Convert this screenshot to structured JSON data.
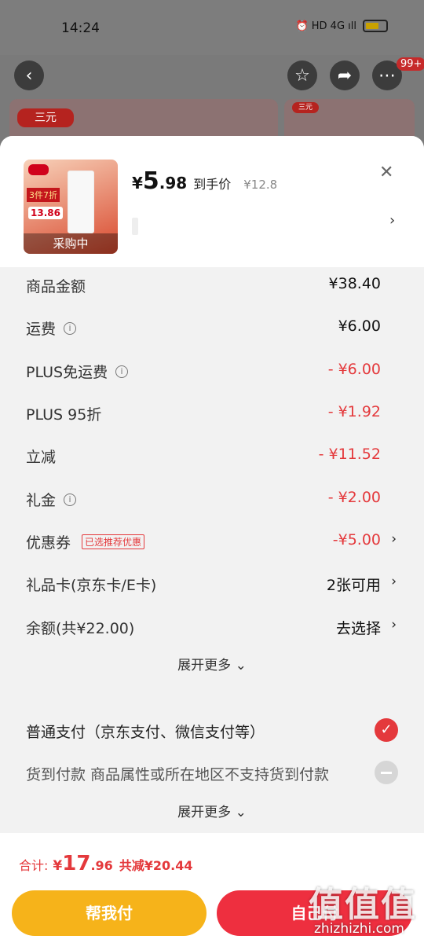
{
  "status": {
    "time": "14:24",
    "icons": "⏰ HD 4G ıll"
  },
  "nav": {
    "badge": "99+"
  },
  "background": {
    "logo1": "三元",
    "logo2": "三元"
  },
  "product": {
    "tag1": "3件7折",
    "tag2": "13.86",
    "status": "采购中",
    "price_symbol": "¥",
    "price_int": "5",
    "price_dec": ".98",
    "price_label": "到手价",
    "original_price": "¥12.8"
  },
  "summary": {
    "rows": [
      {
        "label": "商品金额",
        "value": "¥38.40",
        "red": false
      },
      {
        "label": "运费",
        "value": "¥6.00",
        "red": false,
        "info": true
      },
      {
        "label": "PLUS免运费",
        "value": "- ¥6.00",
        "red": true,
        "info": true
      },
      {
        "label": "PLUS 95折",
        "value": "- ¥1.92",
        "red": true
      },
      {
        "label": "立减",
        "value": "- ¥11.52",
        "red": true
      },
      {
        "label": "礼金",
        "value": "- ¥2.00",
        "red": true,
        "info": true
      },
      {
        "label": "优惠券",
        "tag": "已选推荐优惠",
        "value": "-¥5.00",
        "red": true,
        "arrow": true
      },
      {
        "label": "礼品卡(京东卡/E卡)",
        "value": "2张可用",
        "red": false,
        "arrow": true
      },
      {
        "label": "余额(共¥22.00)",
        "value": "去选择",
        "red": false,
        "arrow": true
      }
    ],
    "more": "展开更多 ⌄"
  },
  "payment": {
    "option1": "普通支付（京东支付、微信支付等）",
    "option2": "货到付款   商品属性或所在地区不支持货到付款",
    "more": "展开更多 ⌄"
  },
  "footer": {
    "total_label": "合计:",
    "total_symbol": "¥",
    "total_int": "17",
    "total_dec": ".96",
    "saved": "共减¥20.44",
    "help_pay": "帮我付",
    "self_pay": "自己付"
  },
  "watermark": {
    "text": "值值值",
    "url": "zhizhizhi.com"
  },
  "colors": {
    "accent_red": "#e4393c",
    "help_yellow": "#f6b31a",
    "pay_red": "#ee2f3f"
  }
}
